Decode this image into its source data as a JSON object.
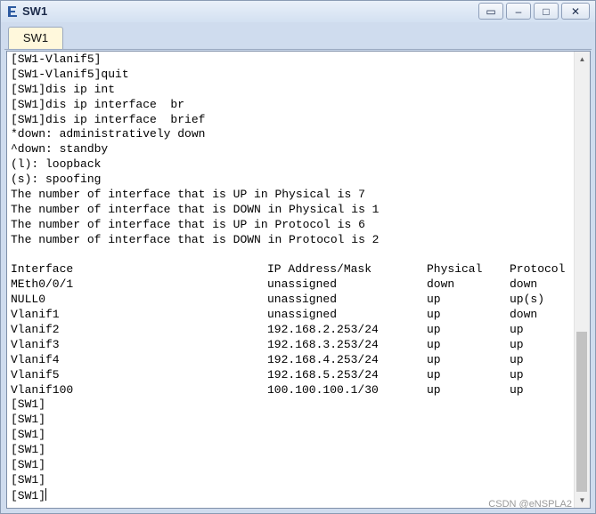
{
  "window": {
    "title": "SW1",
    "controls": {
      "restore": "▭",
      "minimize": "–",
      "maximize": "□",
      "close": "✕"
    }
  },
  "tabs": [
    {
      "label": "SW1",
      "active": true
    }
  ],
  "terminal": {
    "lines_top": [
      "[SW1-Vlanif5]",
      "[SW1-Vlanif5]quit",
      "[SW1]dis ip int",
      "[SW1]dis ip interface  br",
      "[SW1]dis ip interface  brief",
      "*down: administratively down",
      "^down: standby",
      "(l): loopback",
      "(s): spoofing",
      "The number of interface that is UP in Physical is 7",
      "The number of interface that is DOWN in Physical is 1",
      "The number of interface that is UP in Protocol is 6",
      "The number of interface that is DOWN in Protocol is 2",
      ""
    ],
    "table_header": {
      "interface": "Interface",
      "ip": "IP Address/Mask",
      "physical": "Physical",
      "protocol": "Protocol"
    },
    "table_rows": [
      {
        "interface": "MEth0/0/1",
        "ip": "unassigned",
        "physical": "down",
        "protocol": "down"
      },
      {
        "interface": "NULL0",
        "ip": "unassigned",
        "physical": "up",
        "protocol": "up(s)"
      },
      {
        "interface": "Vlanif1",
        "ip": "unassigned",
        "physical": "up",
        "protocol": "down"
      },
      {
        "interface": "Vlanif2",
        "ip": "192.168.2.253/24",
        "physical": "up",
        "protocol": "up"
      },
      {
        "interface": "Vlanif3",
        "ip": "192.168.3.253/24",
        "physical": "up",
        "protocol": "up"
      },
      {
        "interface": "Vlanif4",
        "ip": "192.168.4.253/24",
        "physical": "up",
        "protocol": "up"
      },
      {
        "interface": "Vlanif5",
        "ip": "192.168.5.253/24",
        "physical": "up",
        "protocol": "up"
      },
      {
        "interface": "Vlanif100",
        "ip": "100.100.100.1/30",
        "physical": "up",
        "protocol": "up"
      }
    ],
    "lines_bottom": [
      "[SW1]",
      "[SW1]",
      "[SW1]",
      "[SW1]",
      "[SW1]",
      "[SW1]"
    ],
    "prompt": "[SW1]",
    "scroll_position": 0.85
  },
  "watermark": "CSDN @eNSPLA2",
  "colors": {
    "accent": "#1c2b4a",
    "tab_active": "#fff8dc",
    "terminal_bg": "#ffffff"
  }
}
